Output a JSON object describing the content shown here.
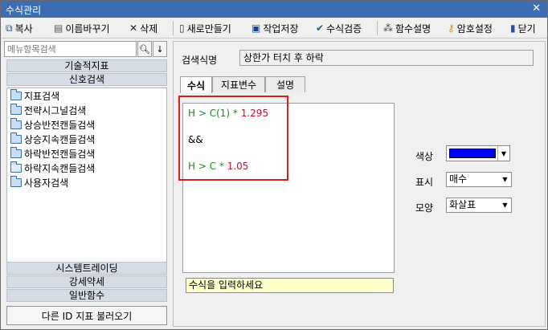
{
  "window": {
    "title": "수식관리",
    "close_glyph": "✕"
  },
  "toolbar": {
    "copy": "복사",
    "rename": "이름바꾸기",
    "delete": "삭제",
    "new": "새로만들기",
    "save": "작업저장",
    "verify": "수식검증",
    "fn_help": "함수설명",
    "password": "암호설정",
    "close": "닫기"
  },
  "left": {
    "search_placeholder": "메뉴항목검색",
    "categories_top": [
      "기술적지표",
      "신호검색"
    ],
    "items": [
      "지표검색",
      "전략시그널검색",
      "상승반전캔들검색",
      "상승지속캔들검색",
      "하락반전캔들검색",
      "하락지속캔들검색",
      "사용자검색"
    ],
    "categories_bottom": [
      "시스템트레이딩",
      "강세약세",
      "일반함수"
    ],
    "load_button": "다른 ID 지표 불러오기"
  },
  "right": {
    "name_label": "검색식명",
    "name_value": "상한가 터치 후 하락",
    "tabs": [
      "수식",
      "지표변수",
      "설명"
    ],
    "formula": {
      "line1_a": "H > C(1) * ",
      "line1_b": "1.295",
      "line2": "&&",
      "line3_a": "H > C * ",
      "line3_b": "1.05"
    },
    "hint": "수식을 입력하세요",
    "color_label": "색상",
    "color_value": "#0000ff",
    "display_label": "표시",
    "display_value": "매수",
    "shape_label": "모양",
    "shape_value": "화살표"
  }
}
